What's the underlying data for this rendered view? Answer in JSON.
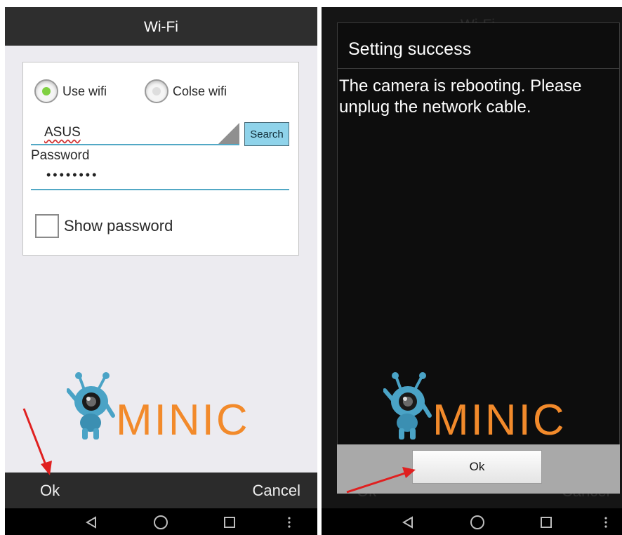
{
  "left": {
    "title": "Wi-Fi",
    "radios": [
      {
        "label": "Use wifi",
        "selected": true
      },
      {
        "label": "Colse wifi",
        "selected": false
      }
    ],
    "ssid_value": "ASUS",
    "search_label": "Search",
    "password_label": "Password",
    "password_value": "••••••••",
    "show_password_label": "Show password",
    "show_password_checked": false,
    "logo_text": "MINIC",
    "ok_label": "Ok",
    "cancel_label": "Cancel"
  },
  "right": {
    "background_title": "Wi-Fi",
    "dialog": {
      "title": "Setting success",
      "message": "The camera is rebooting. Please unplug the network cable.",
      "ok_label": "Ok"
    }
  },
  "nav_icons": [
    "back-icon",
    "home-icon",
    "recents-icon",
    "menu-dots-icon"
  ],
  "colors": {
    "accent_blue": "#52a8c5",
    "search_button_bg": "#8fd3ea",
    "radio_selected": "#7fd041",
    "logo_orange": "#f28a2b",
    "logo_robot": "#4aa3c6",
    "annotation_arrow": "#e02020",
    "title_bar": "#2e2e2e"
  }
}
